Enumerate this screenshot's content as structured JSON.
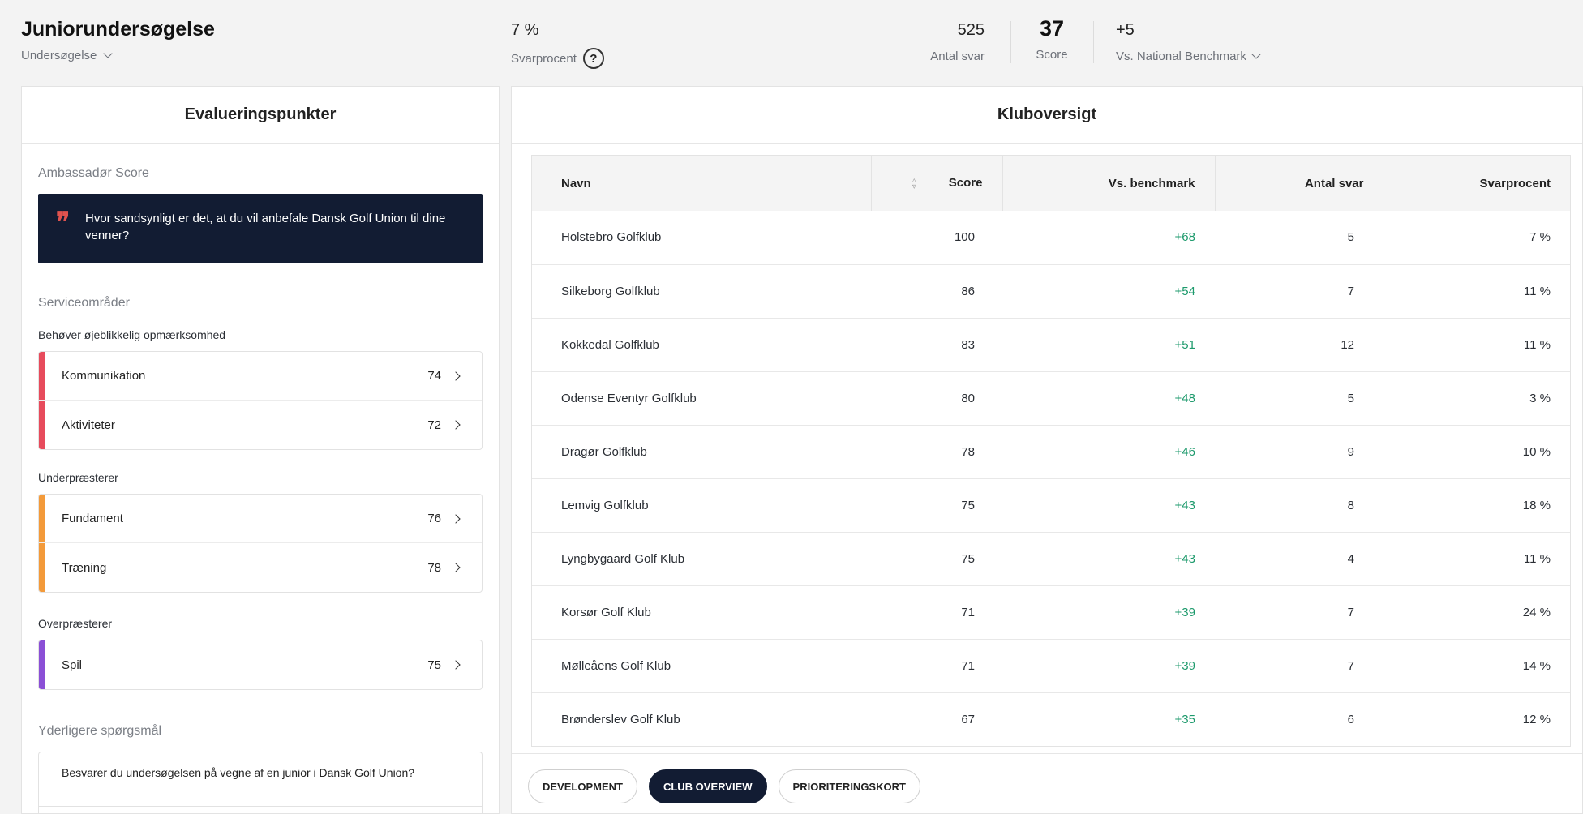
{
  "header": {
    "title": "Juniorundersøgelse",
    "survey_dropdown": "Undersøgelse",
    "response_rate_value": "7 %",
    "response_rate_label": "Svarprocent",
    "responses_value": "525",
    "responses_label": "Antal svar",
    "score_value": "37",
    "score_label": "Score",
    "benchmark_value": "+5",
    "benchmark_label": "Vs. National Benchmark"
  },
  "left_panel": {
    "title": "Evalueringspunkter",
    "ambassador_label": "Ambassadør Score",
    "ambassador_question": "Hvor sandsynligt er det, at du vil anbefale Dansk Golf Union til dine venner?",
    "service_label": "Serviceområder",
    "groups": [
      {
        "label": "Behøver øjeblikkelig opmærksomhed",
        "color": "#e74b5c",
        "items": [
          {
            "name": "Kommunikation",
            "value": "74"
          },
          {
            "name": "Aktiviteter",
            "value": "72"
          }
        ]
      },
      {
        "label": "Underpræsterer",
        "color": "#f39a3a",
        "items": [
          {
            "name": "Fundament",
            "value": "76"
          },
          {
            "name": "Træning",
            "value": "78"
          }
        ]
      },
      {
        "label": "Overpræsterer",
        "color": "#8b4fd6",
        "items": [
          {
            "name": "Spil",
            "value": "75"
          }
        ]
      }
    ],
    "extra_label": "Yderligere spørgsmål",
    "extra_question": "Besvarer du undersøgelsen på vegne af en junior i Dansk Golf Union?"
  },
  "right_panel": {
    "title": "Kluboversigt",
    "columns": [
      "Navn",
      "Score",
      "Vs. benchmark",
      "Antal svar",
      "Svarprocent"
    ],
    "rows": [
      {
        "name": "Holstebro Golfklub",
        "score": "100",
        "bench": "+68",
        "count": "5",
        "rate": "7 %"
      },
      {
        "name": "Silkeborg Golfklub",
        "score": "86",
        "bench": "+54",
        "count": "7",
        "rate": "11 %"
      },
      {
        "name": "Kokkedal Golfklub",
        "score": "83",
        "bench": "+51",
        "count": "12",
        "rate": "11 %"
      },
      {
        "name": "Odense Eventyr Golfklub",
        "score": "80",
        "bench": "+48",
        "count": "5",
        "rate": "3 %"
      },
      {
        "name": "Dragør Golfklub",
        "score": "78",
        "bench": "+46",
        "count": "9",
        "rate": "10 %"
      },
      {
        "name": "Lemvig Golfklub",
        "score": "75",
        "bench": "+43",
        "count": "8",
        "rate": "18 %"
      },
      {
        "name": "Lyngbygaard Golf Klub",
        "score": "75",
        "bench": "+43",
        "count": "4",
        "rate": "11 %"
      },
      {
        "name": "Korsør Golf Klub",
        "score": "71",
        "bench": "+39",
        "count": "7",
        "rate": "24 %"
      },
      {
        "name": "Mølleåens Golf Klub",
        "score": "71",
        "bench": "+39",
        "count": "7",
        "rate": "14 %"
      },
      {
        "name": "Brønderslev Golf Klub",
        "score": "67",
        "bench": "+35",
        "count": "6",
        "rate": "12 %"
      }
    ],
    "tabs": [
      {
        "label": "DEVELOPMENT",
        "active": false
      },
      {
        "label": "CLUB OVERVIEW",
        "active": true
      },
      {
        "label": "PRIORITERINGSKORT",
        "active": false
      }
    ]
  },
  "colors": {
    "navy": "#121c33",
    "positive": "#1d9a6c",
    "quote_accent": "#e0524e"
  },
  "icons": [
    "chevron-down-icon",
    "help-circle-icon",
    "quote-icon",
    "chevron-right-icon",
    "sort-icon"
  ]
}
